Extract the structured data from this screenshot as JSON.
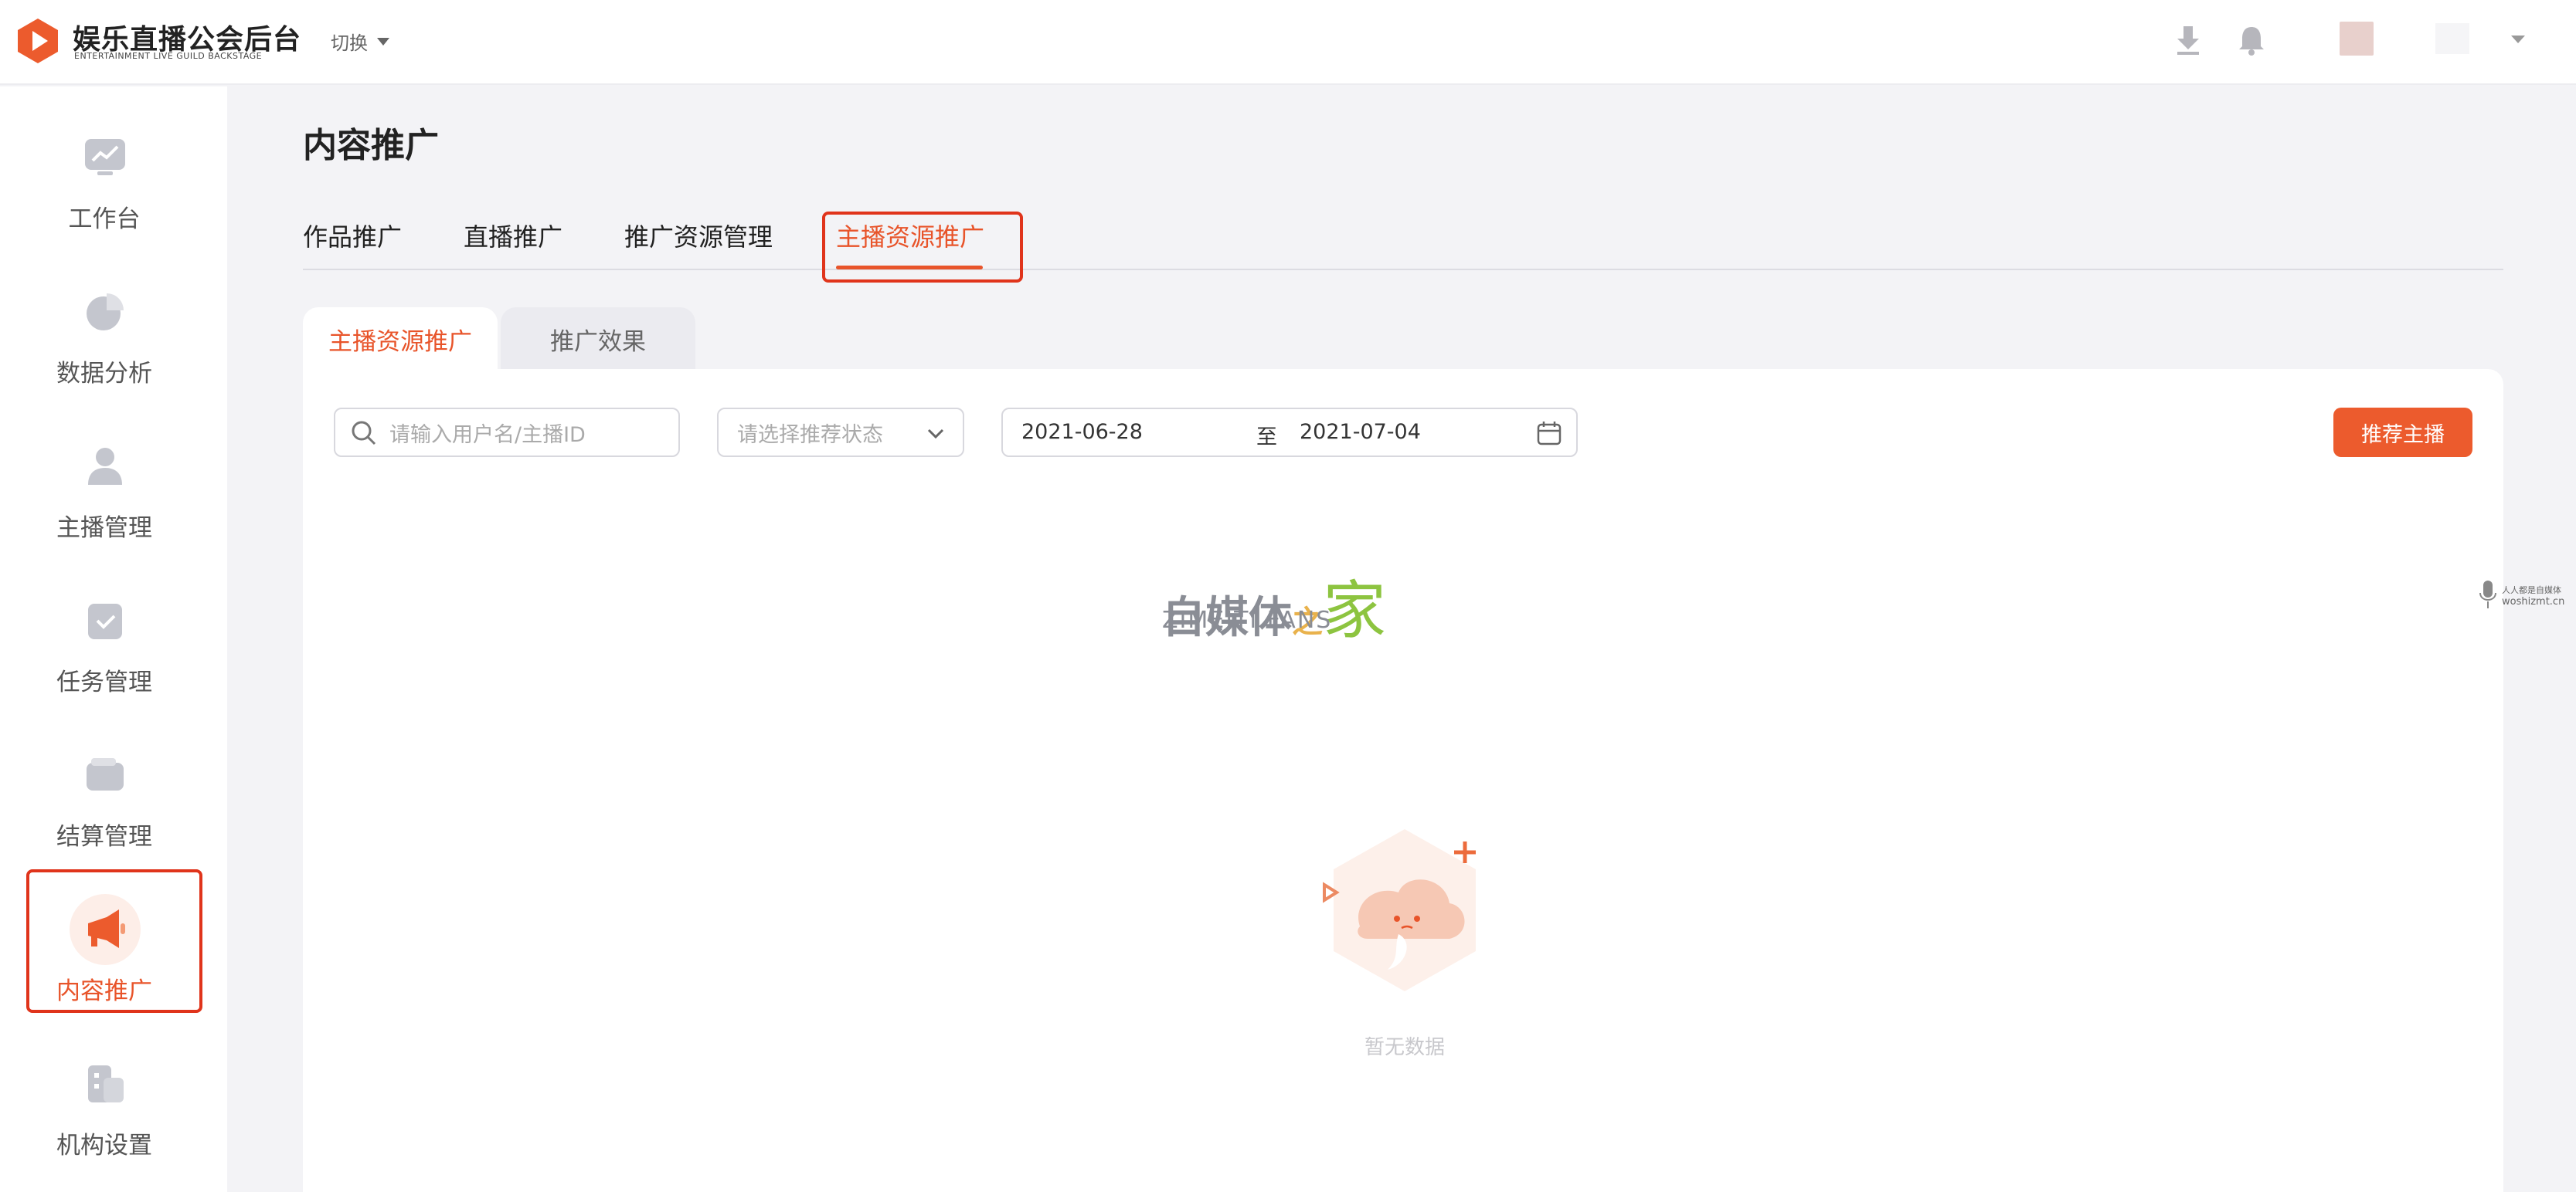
{
  "brand": {
    "title": "娱乐直播公会后台",
    "subtitle": "ENTERTAINMENT LIVE GUILD BACKSTAGE",
    "switch_label": "切换",
    "accent": "#e8542a"
  },
  "header": {
    "icons": [
      "download-icon",
      "bell-icon"
    ]
  },
  "sidebar": {
    "items": [
      {
        "label": "工作台",
        "icon": "dashboard-chart-icon"
      },
      {
        "label": "数据分析",
        "icon": "pie-chart-icon"
      },
      {
        "label": "主播管理",
        "icon": "user-icon"
      },
      {
        "label": "任务管理",
        "icon": "clipboard-check-icon"
      },
      {
        "label": "结算管理",
        "icon": "wallet-icon"
      },
      {
        "label": "内容推广",
        "icon": "megaphone-icon",
        "active": true
      },
      {
        "label": "机构设置",
        "icon": "building-settings-icon"
      }
    ]
  },
  "main": {
    "page_title": "内容推广",
    "tabs": [
      {
        "label": "作品推广"
      },
      {
        "label": "直播推广"
      },
      {
        "label": "推广资源管理"
      },
      {
        "label": "主播资源推广",
        "active": true
      }
    ],
    "subtabs": [
      {
        "label": "主播资源推广",
        "active": true
      },
      {
        "label": "推广效果"
      }
    ],
    "filters": {
      "search_placeholder": "请输入用户名/主播ID",
      "status_placeholder": "请选择推荐状态",
      "date_start": "2021-06-28",
      "date_separator": "至",
      "date_end": "2021-07-04"
    },
    "primary_button": "推荐主播",
    "empty_text": "暂无数据"
  },
  "watermark": {
    "zh_main": "自媒体",
    "zh_mid": "之",
    "zh_end": "家",
    "en": "ZIMEITI.FANS",
    "corner_line1": "人人都是自媒体",
    "corner_line2": "woshizmt.cn"
  }
}
